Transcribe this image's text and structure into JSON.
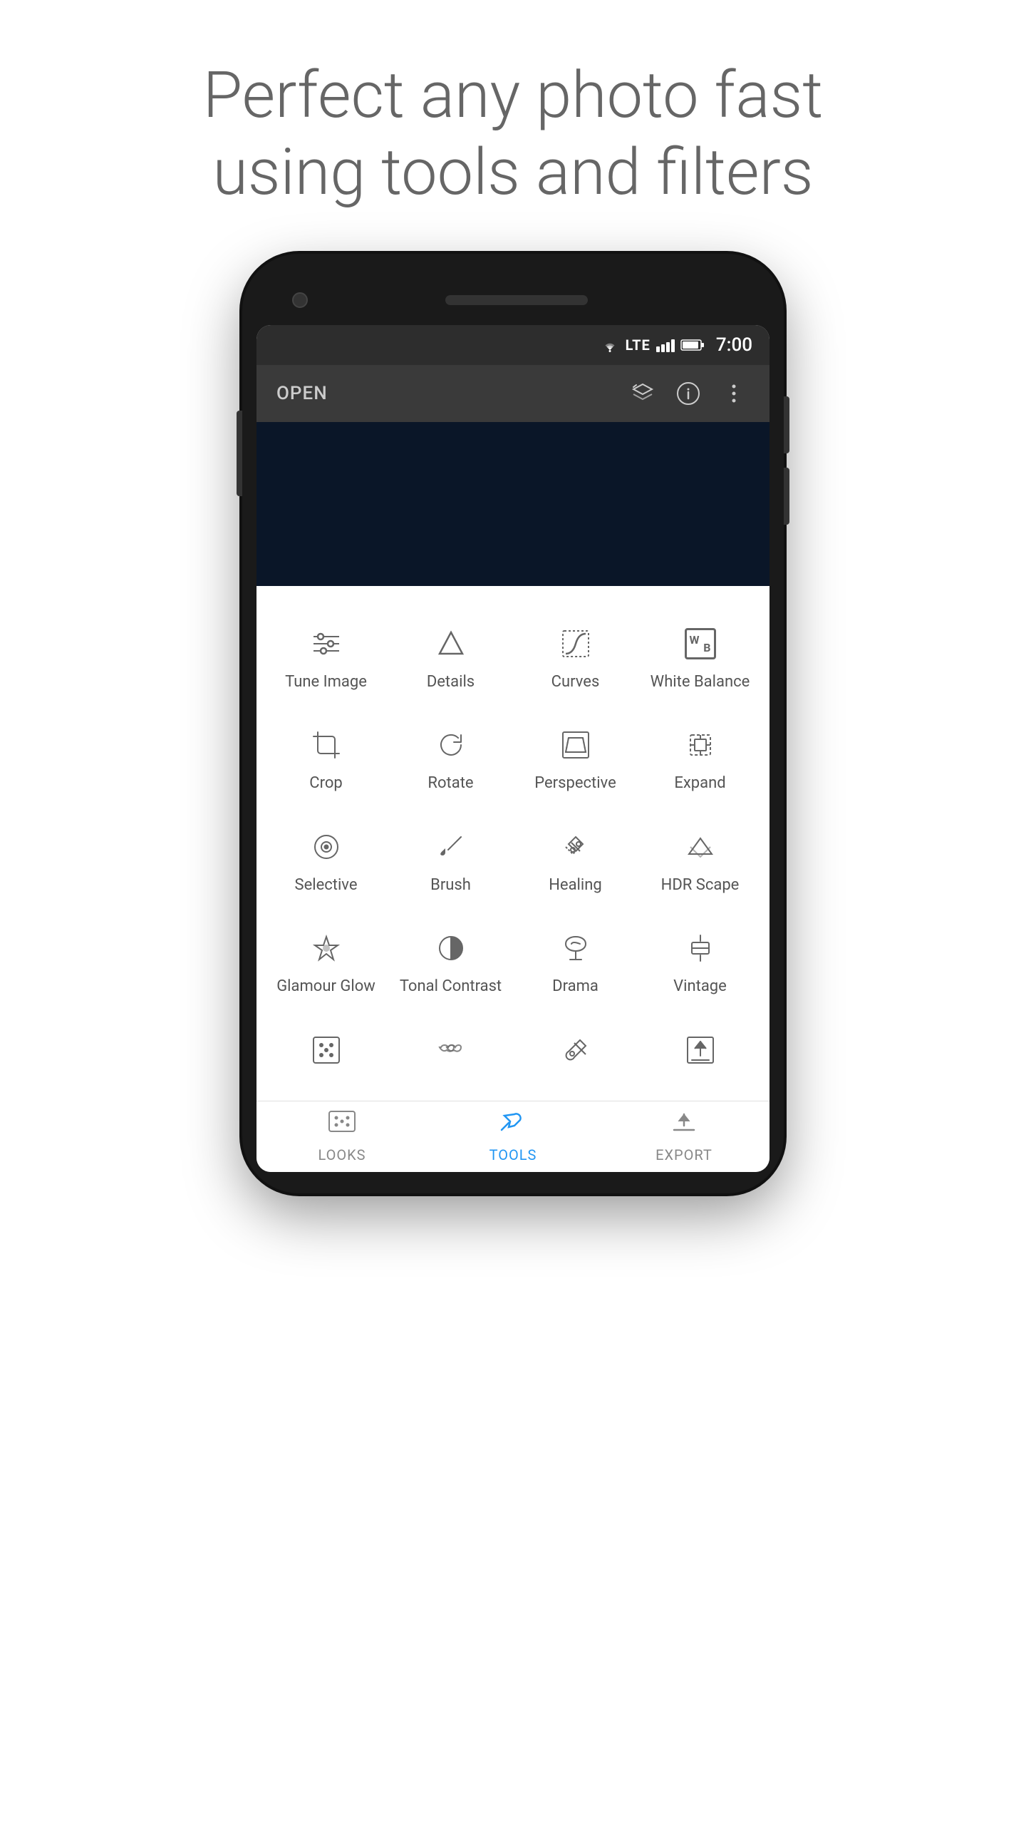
{
  "hero": {
    "line1": "Perfect any photo fast",
    "line2": "using tools and filters"
  },
  "status_bar": {
    "time": "7:00"
  },
  "toolbar": {
    "open_label": "OPEN"
  },
  "tools": [
    {
      "id": "tune-image",
      "label": "Tune Image",
      "icon": "tune"
    },
    {
      "id": "details",
      "label": "Details",
      "icon": "details"
    },
    {
      "id": "curves",
      "label": "Curves",
      "icon": "curves"
    },
    {
      "id": "white-balance",
      "label": "White Balance",
      "icon": "wb"
    },
    {
      "id": "crop",
      "label": "Crop",
      "icon": "crop"
    },
    {
      "id": "rotate",
      "label": "Rotate",
      "icon": "rotate"
    },
    {
      "id": "perspective",
      "label": "Perspective",
      "icon": "perspective"
    },
    {
      "id": "expand",
      "label": "Expand",
      "icon": "expand"
    },
    {
      "id": "selective",
      "label": "Selective",
      "icon": "selective"
    },
    {
      "id": "brush",
      "label": "Brush",
      "icon": "brush"
    },
    {
      "id": "healing",
      "label": "Healing",
      "icon": "healing"
    },
    {
      "id": "hdr-scape",
      "label": "HDR Scape",
      "icon": "hdr"
    },
    {
      "id": "glamour-glow",
      "label": "Glamour Glow",
      "icon": "glamour"
    },
    {
      "id": "tonal-contrast",
      "label": "Tonal Contrast",
      "icon": "tonal"
    },
    {
      "id": "drama",
      "label": "Drama",
      "icon": "drama"
    },
    {
      "id": "vintage",
      "label": "Vintage",
      "icon": "vintage"
    },
    {
      "id": "looks",
      "label": "Looks",
      "icon": "looks"
    },
    {
      "id": "tools",
      "label": "Tools",
      "icon": "tools_nav"
    },
    {
      "id": "export",
      "label": "Export",
      "icon": "export"
    }
  ],
  "bottom_nav": [
    {
      "id": "looks",
      "label": "LOOKS",
      "active": false
    },
    {
      "id": "tools",
      "label": "TOOLS",
      "active": true
    },
    {
      "id": "export",
      "label": "EXPORT",
      "active": false
    }
  ]
}
